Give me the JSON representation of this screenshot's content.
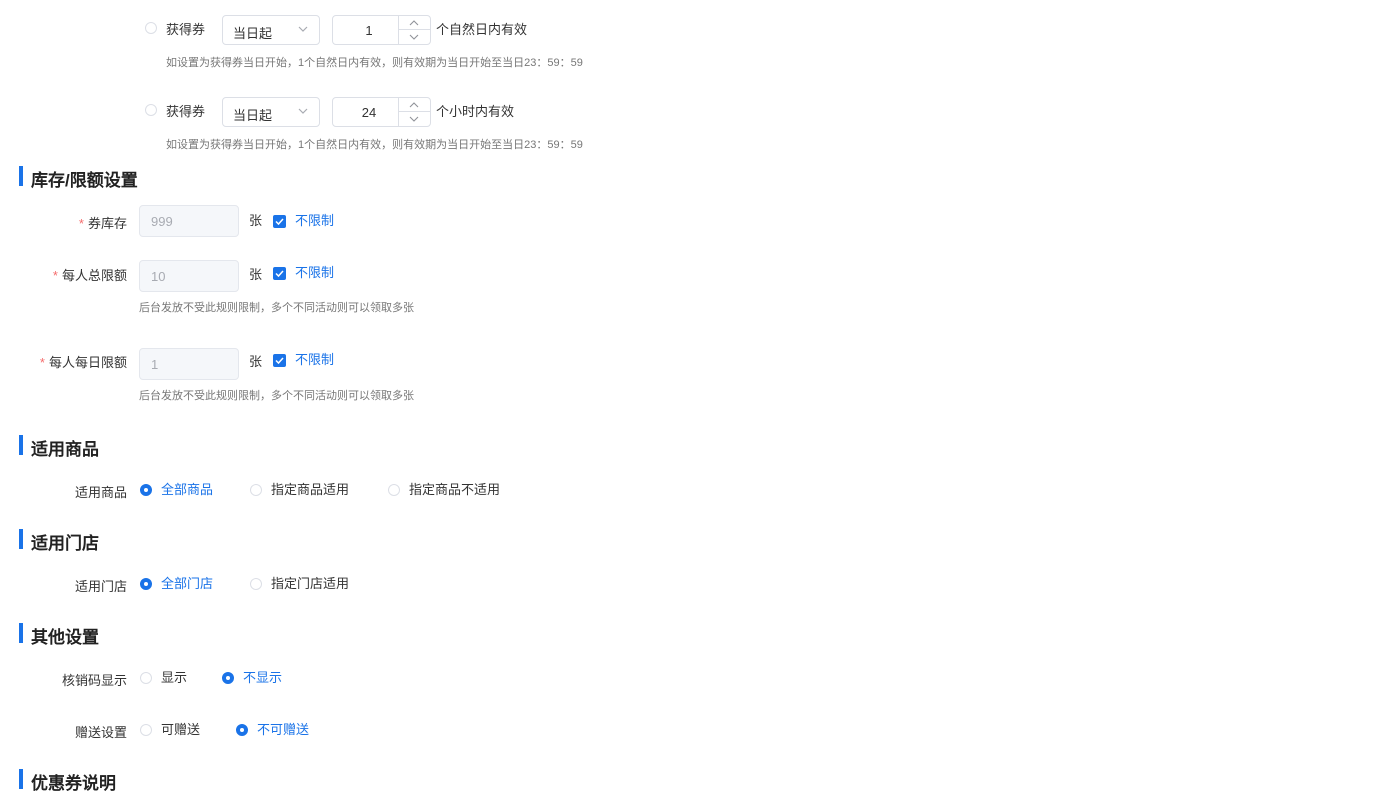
{
  "validity": [
    {
      "radio_label": "获得券",
      "select_value": "当日起",
      "number_value": "1",
      "suffix": "个自然日内有效",
      "hint": "如设置为获得券当日开始，1个自然日内有效，则有效期为当日开始至当日23：59：59"
    },
    {
      "radio_label": "获得券",
      "select_value": "当日起",
      "number_value": "24",
      "suffix": "个小时内有效",
      "hint": "如设置为获得券当日开始，1个自然日内有效，则有效期为当日开始至当日23：59：59"
    }
  ],
  "stock_section": {
    "title": "库存/限额设置",
    "required_mark": "*",
    "unit": "张",
    "unlimited_label": "不限制",
    "hint": "后台发放不受此规则限制，多个不同活动则可以领取多张",
    "fields": [
      {
        "label": "券库存",
        "value": "999",
        "unlimited": true
      },
      {
        "label": "每人总限额",
        "value": "10",
        "unlimited": true
      },
      {
        "label": "每人每日限额",
        "value": "1",
        "unlimited": true
      }
    ]
  },
  "goods_section": {
    "title": "适用商品",
    "label": "适用商品",
    "options": [
      "全部商品",
      "指定商品适用",
      "指定商品不适用"
    ],
    "selected": "全部商品"
  },
  "store_section": {
    "title": "适用门店",
    "label": "适用门店",
    "options": [
      "全部门店",
      "指定门店适用"
    ],
    "selected": "全部门店"
  },
  "other_section": {
    "title": "其他设置",
    "verify_code": {
      "label": "核销码显示",
      "options": [
        "显示",
        "不显示"
      ],
      "selected": "不显示"
    },
    "gift": {
      "label": "赠送设置",
      "options": [
        "可赠送",
        "不可赠送"
      ],
      "selected": "不可赠送"
    }
  },
  "desc_section": {
    "title": "优惠券说明"
  },
  "colors": {
    "accent": "#1a73e8",
    "required": "#f56c6c"
  }
}
